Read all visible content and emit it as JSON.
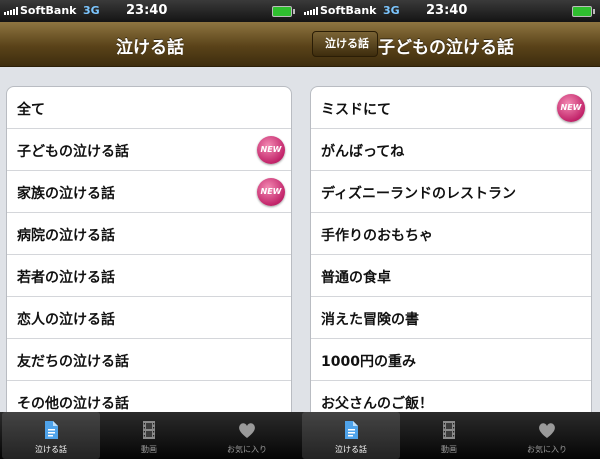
{
  "status": {
    "carrier": "SoftBank",
    "network": "3G",
    "time": "23:40"
  },
  "left": {
    "nav_title": "泣ける話",
    "items": [
      {
        "label": "全て",
        "badge": ""
      },
      {
        "label": "子どもの泣ける話",
        "badge": "NEW"
      },
      {
        "label": "家族の泣ける話",
        "badge": "NEW"
      },
      {
        "label": "病院の泣ける話",
        "badge": ""
      },
      {
        "label": "若者の泣ける話",
        "badge": ""
      },
      {
        "label": "恋人の泣ける話",
        "badge": ""
      },
      {
        "label": "友だちの泣ける話",
        "badge": ""
      },
      {
        "label": "その他の泣ける話",
        "badge": ""
      }
    ]
  },
  "right": {
    "back_label": "泣ける話",
    "nav_title": "子どもの泣ける話",
    "items": [
      {
        "label": "ミスドにて",
        "badge": "NEW"
      },
      {
        "label": "がんばってね",
        "badge": ""
      },
      {
        "label": "ディズニーランドのレストラン",
        "badge": ""
      },
      {
        "label": "手作りのおもちゃ",
        "badge": ""
      },
      {
        "label": "普通の食卓",
        "badge": ""
      },
      {
        "label": "消えた冒険の書",
        "badge": ""
      },
      {
        "label": "1000円の重み",
        "badge": ""
      },
      {
        "label": "お父さんのご飯！",
        "badge": ""
      }
    ]
  },
  "tabs": [
    {
      "label": "泣ける話",
      "icon": "document-icon"
    },
    {
      "label": "動画",
      "icon": "film-icon"
    },
    {
      "label": "お気に入り",
      "icon": "heart-icon"
    }
  ]
}
